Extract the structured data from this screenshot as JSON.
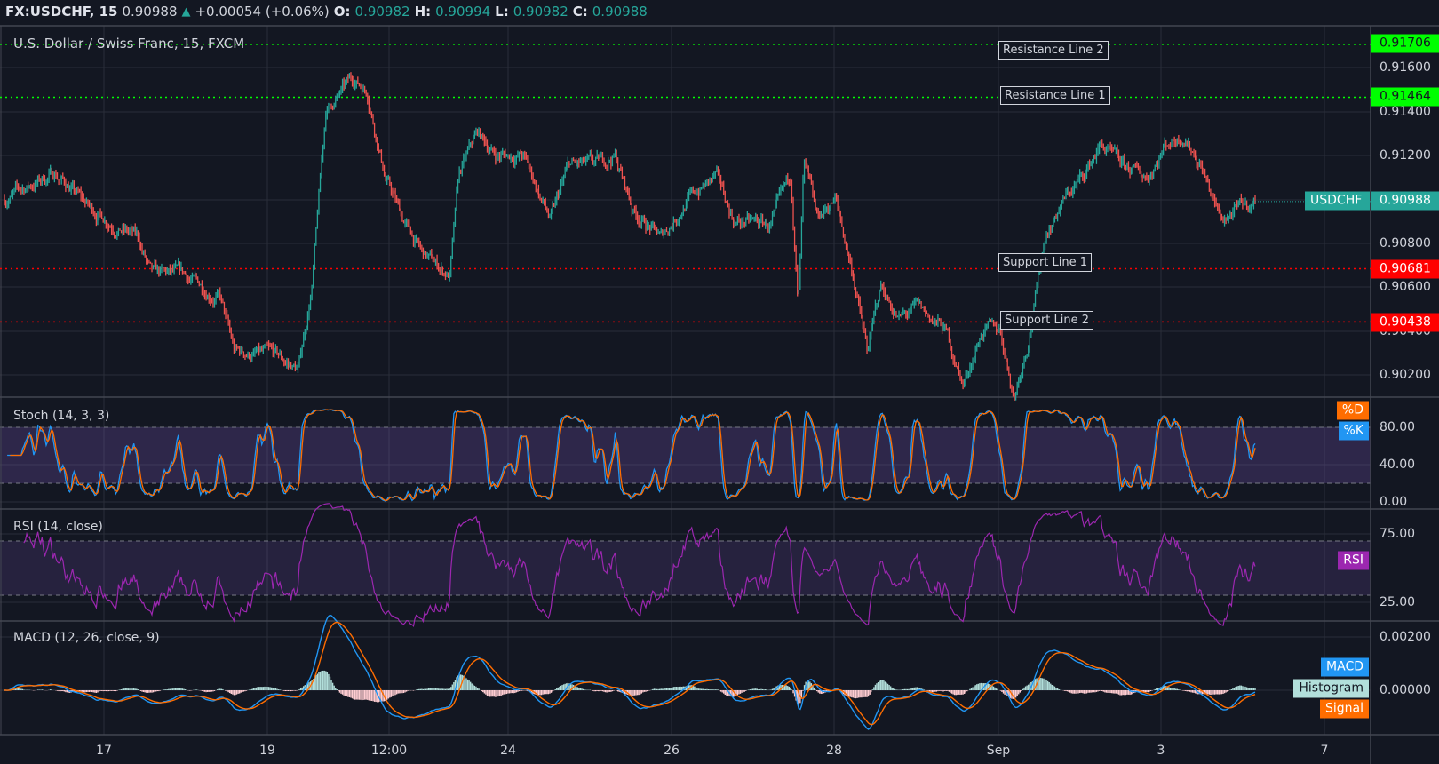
{
  "header": {
    "symbol": "FX:USDCHF, 15",
    "last": "0.90988",
    "change": "+0.00054 (+0.06%)",
    "open_label": "O:",
    "open": "0.90982",
    "high_label": "H:",
    "high": "0.90994",
    "low_label": "L:",
    "low": "0.90982",
    "close_label": "C:",
    "close": "0.90988",
    "direction_icon": "triangle-up-icon"
  },
  "main_pane": {
    "title": "U.S. Dollar / Swiss Franc, 15, FXCM",
    "price_axis": [
      "0.91600",
      "0.91400",
      "0.91200",
      "0.90800",
      "0.90600",
      "0.90400",
      "0.90200"
    ],
    "current_price": {
      "symbol": "USDCHF",
      "value": "0.90988",
      "color": "#26a69a"
    },
    "horizontal_lines": [
      {
        "label": "Resistance Line 2",
        "value": "0.91706",
        "color": "#00ff00"
      },
      {
        "label": "Resistance Line 1",
        "value": "0.91464",
        "color": "#00ff00"
      },
      {
        "label": "Support Line 1",
        "value": "0.90681",
        "color": "#ff0000"
      },
      {
        "label": "Support Line 2",
        "value": "0.90438",
        "color": "#ff0000"
      }
    ],
    "candle_colors": {
      "up": "#26a69a",
      "down": "#ef5350"
    }
  },
  "stoch_pane": {
    "title": "Stoch (14, 3, 3)",
    "axis": [
      "80.00",
      "40.00",
      "0.00"
    ],
    "legend": [
      {
        "label": "%D",
        "color": "#ff6d00"
      },
      {
        "label": "%K",
        "color": "#2196f3"
      }
    ],
    "bands": [
      80,
      20
    ]
  },
  "rsi_pane": {
    "title": "RSI (14, close)",
    "axis": [
      "75.00",
      "25.00"
    ],
    "legend": [
      {
        "label": "RSI",
        "color": "#9c27b0"
      }
    ],
    "bands": [
      70,
      30
    ]
  },
  "macd_pane": {
    "title": "MACD (12, 26, close, 9)",
    "axis": [
      "0.00200",
      "0.00000"
    ],
    "legend": [
      {
        "label": "MACD",
        "color": "#2196f3"
      },
      {
        "label": "Histogram",
        "color": "#b2dfdb"
      },
      {
        "label": "Signal",
        "color": "#ff6d00"
      }
    ]
  },
  "time_axis": [
    "17",
    "19",
    "12:00",
    "24",
    "26",
    "28",
    "Sep",
    "3",
    "7"
  ]
}
